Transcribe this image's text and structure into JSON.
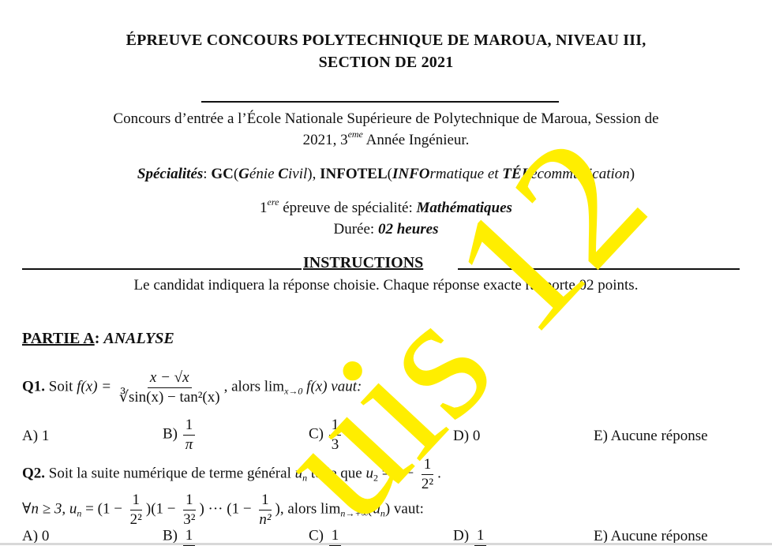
{
  "header": {
    "title_line1": "ÉPREUVE CONCOURS POLYTECHNIQUE DE MAROUA, NIVEAU III,",
    "title_line2": "SECTION DE 2021"
  },
  "intro": {
    "line1": "Concours d’entrée a l’École Nationale Supérieure de Polytechnique de Maroua, Session de",
    "line2_a": "2021, 3",
    "line2_sup": "eme",
    "line2_b": " Année Ingénieur."
  },
  "specialites": {
    "label": "Spécialités",
    "gc": "GC",
    "gc_detail_g": "G",
    "gc_detail_1": "énie ",
    "gc_detail_c": "C",
    "gc_detail_2": "ivil",
    "infotel": "INFOTEL",
    "info_bold": "INFO",
    "info_rest": "rmatique et ",
    "tel_bold": "TÉL",
    "tel_rest": "écommunication"
  },
  "epreuve": {
    "num": "1",
    "sup": "ere",
    "text": " épreuve de spécialité: ",
    "subject": "Mathématiques",
    "duree_label": "Durée: ",
    "duree_value": "02 heures"
  },
  "instructions": {
    "heading": "INSTRUCTIONS",
    "text": "Le candidat indiquera la réponse choisie. Chaque réponse exacte rapporte 02 points."
  },
  "partie": {
    "label": "PARTIE A",
    "name": "ANALYSE"
  },
  "q1": {
    "label": "Q1.",
    "text_before": "Soit ",
    "fx": "f(x) =",
    "numerator": "x − √x",
    "denominator": "∛sin(x) − tan²(x)",
    "text_after": ", alors lim",
    "lim_sub": "x→0",
    "text_end": " f(x) vaut:",
    "options": [
      {
        "label": "A) ",
        "value": "1"
      },
      {
        "label": "B) ",
        "num": "1",
        "den": "π"
      },
      {
        "label": "C) ",
        "num": "1",
        "den": "3"
      },
      {
        "label": "D) ",
        "value": "0"
      },
      {
        "label": "E) ",
        "value": "Aucune réponse"
      }
    ]
  },
  "q2": {
    "label": "Q2.",
    "text": "Soit la suite numérique de terme général ",
    "un": "u",
    "un_sub": "n",
    "text2": " telle que ",
    "u2": "u",
    "u2_sub": "2",
    "eq": " = 1 − ",
    "frac_num": "1",
    "frac_den": "2²",
    "line2_a": "∀n ≥ 3, u",
    "line2_sub": "n",
    "line2_b": " = (1 − ",
    "f1_den": "2²",
    "f2_den": "3²",
    "fn_den": "n²",
    "dots": ")(1 − ",
    "cdots": ") ··· (1 − ",
    "line2_c": "), alors lim",
    "lim_sub": "n→+∞",
    "line2_d": "(u",
    "line2_d_sub": "n",
    "line2_e": ") vaut:",
    "options": [
      {
        "label": "A) ",
        "value": "0"
      },
      {
        "label": "B) ",
        "num": "1"
      },
      {
        "label": "C) ",
        "num": "1"
      },
      {
        "label": "D) ",
        "num": "1"
      },
      {
        "label": "E) ",
        "value": "Aucune réponse"
      }
    ]
  },
  "watermark": {
    "text": "uis 12",
    "color": "#ffee00"
  }
}
